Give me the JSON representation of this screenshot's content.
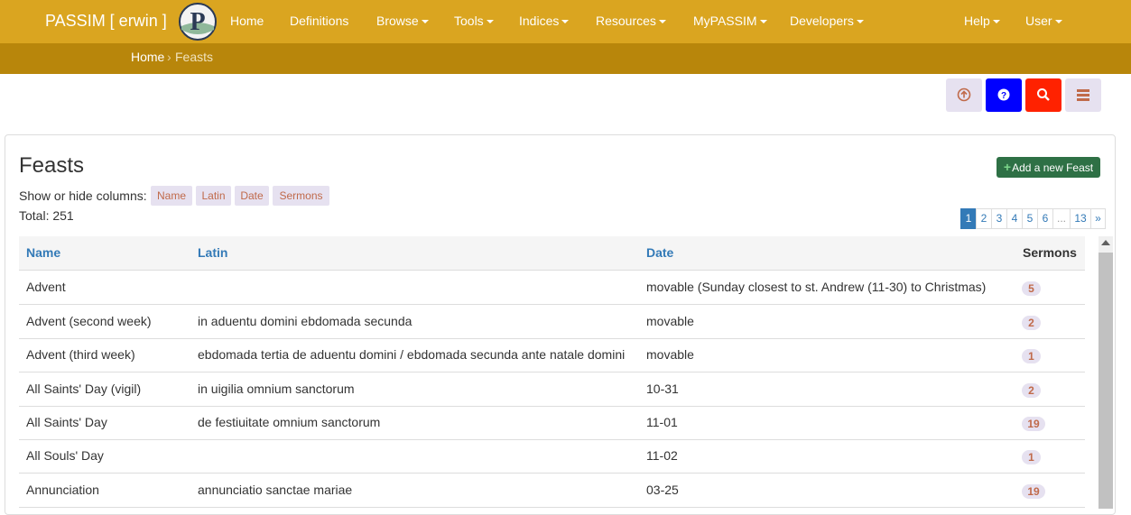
{
  "navbar": {
    "brand": "PASSIM [ erwin ]",
    "logo_letter": "P",
    "items": [
      "Home",
      "Definitions",
      "Browse",
      "Tools",
      "Indices",
      "Resources",
      "MyPASSIM",
      "Developers"
    ],
    "right_items": [
      "Help",
      "User"
    ]
  },
  "breadcrumb": {
    "home": "Home",
    "separator": "›",
    "current": "Feasts"
  },
  "actions": [
    {
      "icon": "upload-circle-icon",
      "color": "#e6e1f0"
    },
    {
      "icon": "help-icon",
      "color": "#0000ff"
    },
    {
      "icon": "search-icon",
      "color": "#ff2200"
    },
    {
      "icon": "list-icon",
      "color": "#e6e1f0"
    }
  ],
  "page": {
    "title": "Feasts",
    "add_button": "Add a new Feast",
    "add_button_plus": "+",
    "show_hide_label": "Show or hide columns:",
    "columns_toggle": [
      "Name",
      "Latin",
      "Date",
      "Sermons"
    ],
    "total": "Total: 251"
  },
  "pagination": [
    "1",
    "2",
    "3",
    "4",
    "5",
    "6",
    "...",
    "13",
    "»"
  ],
  "table": {
    "headers": [
      "Name",
      "Latin",
      "Date",
      "Sermons"
    ],
    "rows": [
      {
        "name": "Advent",
        "latin": "",
        "date": "movable (Sunday closest to st. Andrew (11-30) to Christmas)",
        "sermons": "5"
      },
      {
        "name": "Advent (second week)",
        "latin": "in aduentu domini ebdomada secunda",
        "date": "movable",
        "sermons": "2"
      },
      {
        "name": "Advent (third week)",
        "latin": "ebdomada tertia de aduentu domini / ebdomada secunda ante natale domini",
        "date": "movable",
        "sermons": "1"
      },
      {
        "name": "All Saints' Day (vigil)",
        "latin": "in uigilia omnium sanctorum",
        "date": "10-31",
        "sermons": "2"
      },
      {
        "name": "All Saints' Day",
        "latin": "de festiuitate omnium sanctorum",
        "date": "11-01",
        "sermons": "19"
      },
      {
        "name": "All Souls' Day",
        "latin": "",
        "date": "11-02",
        "sermons": "1"
      },
      {
        "name": "Annunciation",
        "latin": "annunciatio sanctae mariae",
        "date": "03-25",
        "sermons": "19"
      }
    ]
  },
  "colors": {
    "navbar": "#daa520",
    "breadcrumb_bar": "#b8860b",
    "link": "#337ab7",
    "add_button": "#2e7045",
    "badge_bg": "#e6e1f0",
    "badge_text": "#c06a4a"
  }
}
